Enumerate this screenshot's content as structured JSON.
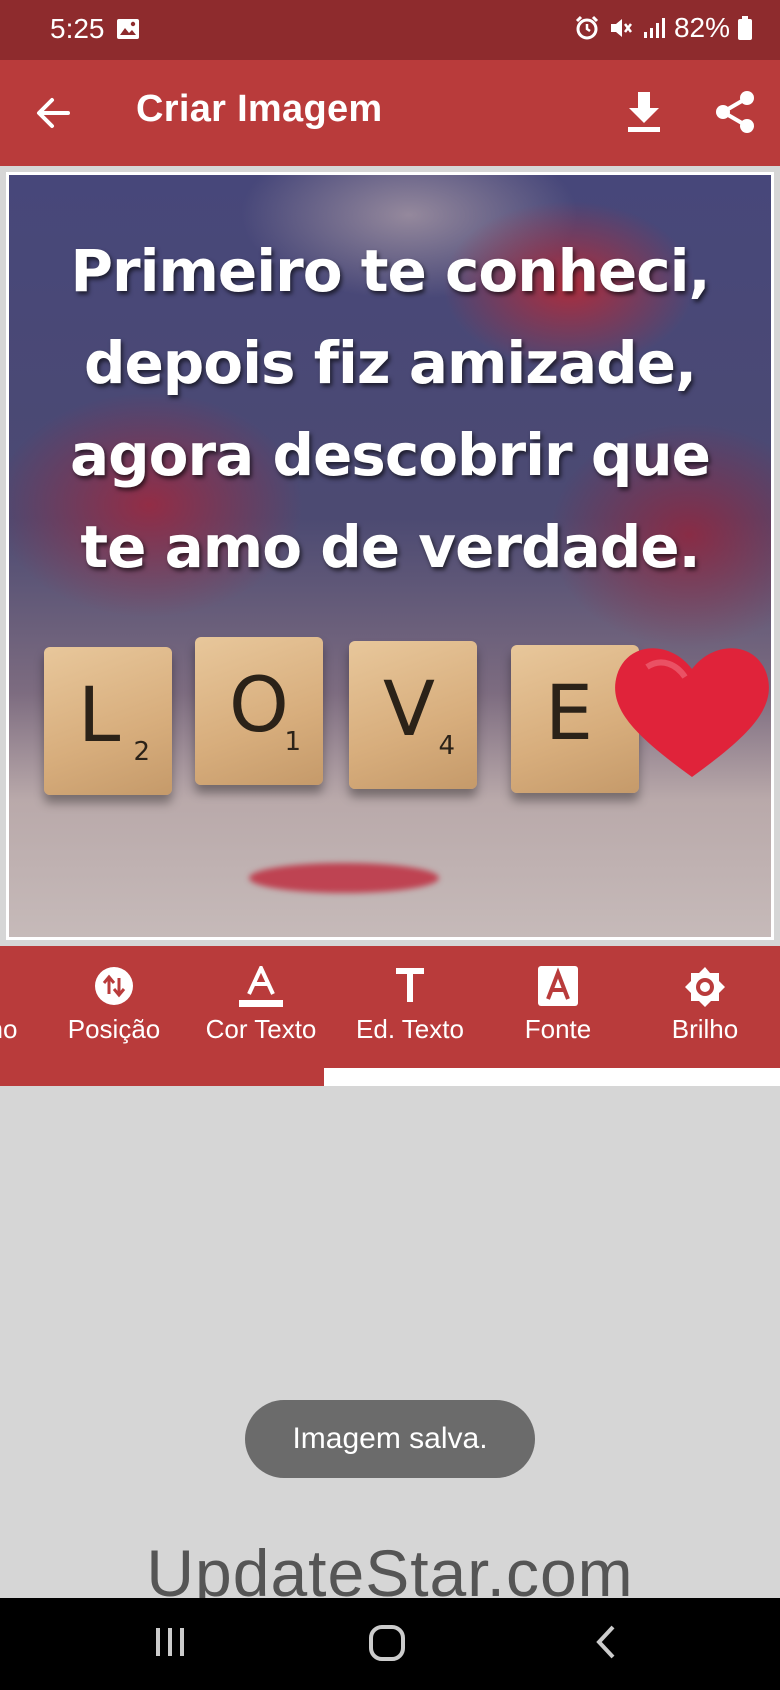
{
  "status_bar": {
    "time": "5:25",
    "battery": "82%",
    "icons": [
      "gallery-icon",
      "alarm-icon",
      "mute-icon",
      "signal-icon",
      "battery-icon"
    ]
  },
  "app_bar": {
    "title": "Criar Imagem",
    "icons": [
      "back-arrow-icon",
      "download-icon",
      "share-icon"
    ]
  },
  "canvas": {
    "quote": "Primeiro te conheci, depois fiz amizade, agora descobrir que te amo de verdade.",
    "tiles": [
      {
        "letter": "L",
        "number": "2"
      },
      {
        "letter": "O",
        "number": "1"
      },
      {
        "letter": "V",
        "number": "4"
      },
      {
        "letter": "E",
        "number": ""
      }
    ]
  },
  "toolbar": {
    "partial_label": "no",
    "tabs": [
      {
        "label": "Posição",
        "icon": "swap-vertical-icon"
      },
      {
        "label": "Cor Texto",
        "icon": "text-color-icon"
      },
      {
        "label": "Ed. Texto",
        "icon": "text-edit-icon"
      },
      {
        "label": "Fonte",
        "icon": "font-icon"
      },
      {
        "label": "Brilho",
        "icon": "brightness-icon"
      }
    ]
  },
  "toast": {
    "message": "Imagem salva."
  },
  "watermark": "UpdateStar.com",
  "colors": {
    "status_bar": "#8e2b2d",
    "accent": "#b93b3b",
    "background": "#d6d6d6",
    "toast": "#6b6b6b"
  }
}
